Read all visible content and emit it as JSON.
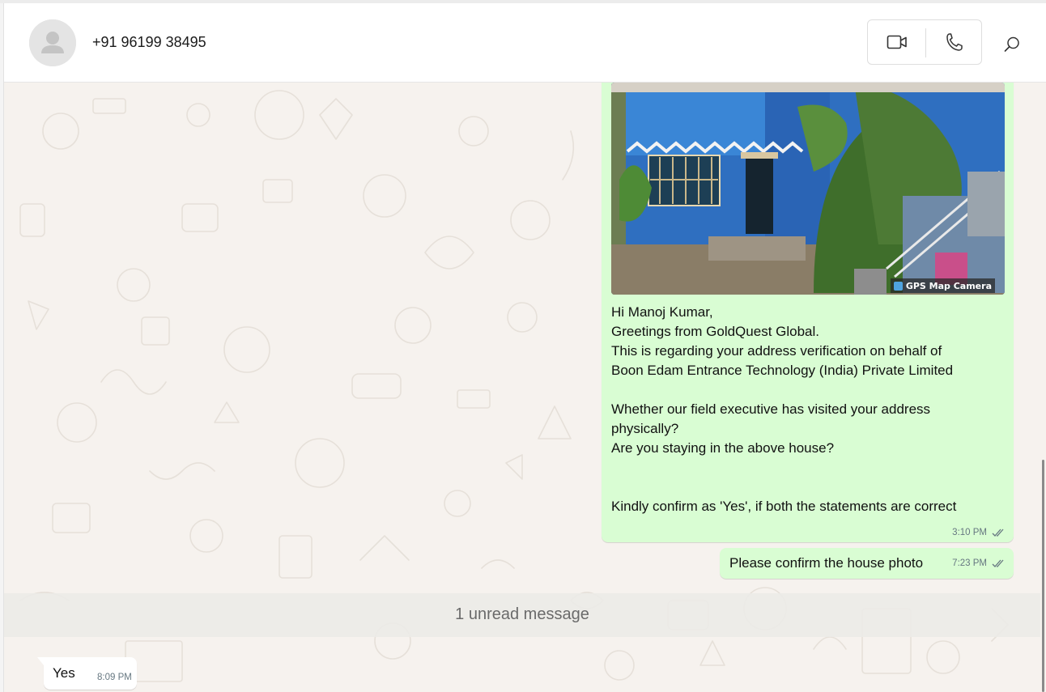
{
  "header": {
    "contact_name": "+91 96199 38495",
    "icons": [
      "avatar-placeholder",
      "video-call-icon",
      "voice-call-icon",
      "search-icon"
    ]
  },
  "messages": [
    {
      "direction": "outgoing",
      "has_image": true,
      "image_badge": "GPS Map Camera",
      "text": "Hi Manoj Kumar,\nGreetings from GoldQuest Global.\nThis is regarding your address verification on behalf of\nBoon Edam Entrance Technology (India) Private Limited\n\nWhether our field executive has visited your address\nphysically?\nAre you staying in the above house?\n\n\nKindly confirm as 'Yes', if both the statements are correct",
      "time": "3:10 PM",
      "status": "read"
    },
    {
      "direction": "outgoing",
      "text": "Please confirm the house photo",
      "time": "7:23 PM",
      "status": "read"
    },
    {
      "direction": "incoming",
      "text": "Yes",
      "time": "8:09 PM"
    }
  ],
  "unread_divider": "1 unread message",
  "colors": {
    "outgoing_bubble": "#d9fdd3",
    "incoming_bubble": "#ffffff",
    "chat_background": "#f6f2ee",
    "meta_text": "#667781"
  }
}
